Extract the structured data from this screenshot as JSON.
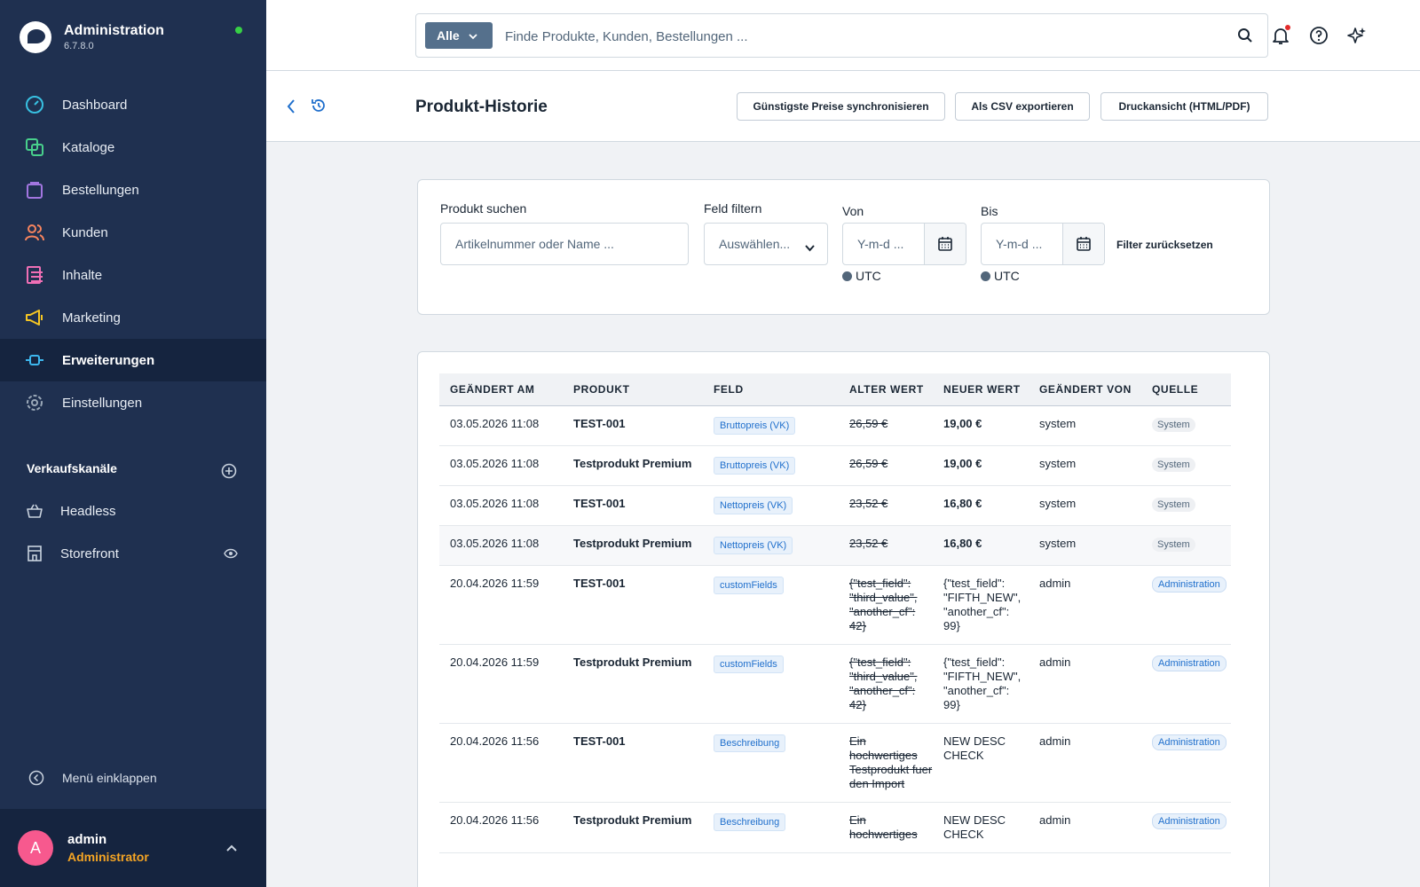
{
  "app": {
    "title": "Administration",
    "version": "6.7.8.0"
  },
  "sidebar": {
    "items": [
      {
        "label": "Dashboard",
        "icon": "dashboard-icon",
        "color": "#38c1e2"
      },
      {
        "label": "Kataloge",
        "icon": "catalog-icon",
        "color": "#48d08c"
      },
      {
        "label": "Bestellungen",
        "icon": "orders-icon",
        "color": "#a276e0"
      },
      {
        "label": "Kunden",
        "icon": "customers-icon",
        "color": "#f7845e"
      },
      {
        "label": "Inhalte",
        "icon": "content-icon",
        "color": "#ef6fb5"
      },
      {
        "label": "Marketing",
        "icon": "marketing-icon",
        "color": "#f5c623"
      },
      {
        "label": "Erweiterungen",
        "icon": "extensions-icon",
        "color": "#3db7ee",
        "active": true
      },
      {
        "label": "Einstellungen",
        "icon": "settings-icon",
        "color": "#9aa8b8"
      }
    ],
    "channels_title": "Verkaufskanäle",
    "channels": [
      {
        "label": "Headless",
        "icon": "basket-icon"
      },
      {
        "label": "Storefront",
        "icon": "storefront-icon"
      }
    ],
    "collapse_label": "Menü einklappen",
    "user": {
      "initial": "A",
      "name": "admin",
      "role": "Administrator"
    }
  },
  "topbar": {
    "search_type": "Alle",
    "search_placeholder": "Finde Produkte, Kunden, Bestellungen ..."
  },
  "page": {
    "title": "Produkt-Historie",
    "buttons": {
      "sync": "Günstigste Preise synchronisieren",
      "csv": "Als CSV exportieren",
      "print": "Druckansicht (HTML/PDF)"
    }
  },
  "filters": {
    "product_label": "Produkt suchen",
    "product_placeholder": "Artikelnummer oder Name ...",
    "field_label": "Feld filtern",
    "field_placeholder": "Auswählen...",
    "from_label": "Von",
    "to_label": "Bis",
    "date_placeholder": "Y-m-d ...",
    "timezone": "UTC",
    "reset": "Filter zurücksetzen"
  },
  "table": {
    "headers": [
      "GEÄNDERT AM",
      "PRODUKT",
      "FELD",
      "ALTER WERT",
      "NEUER WERT",
      "GEÄNDERT VON",
      "QUELLE"
    ],
    "rows": [
      {
        "date": "03.05.2026 11:08",
        "product": "TEST-001",
        "field": "Bruttopreis (VK)",
        "old": "26,59 €",
        "new": "19,00 €",
        "by": "system",
        "source": "System"
      },
      {
        "date": "03.05.2026 11:08",
        "product": "Testprodukt Premium",
        "field": "Bruttopreis (VK)",
        "old": "26,59 €",
        "new": "19,00 €",
        "by": "system",
        "source": "System"
      },
      {
        "date": "03.05.2026 11:08",
        "product": "TEST-001",
        "field": "Nettopreis (VK)",
        "old": "23,52 €",
        "new": "16,80 €",
        "by": "system",
        "source": "System"
      },
      {
        "date": "03.05.2026 11:08",
        "product": "Testprodukt Premium",
        "field": "Nettopreis (VK)",
        "old": "23,52 €",
        "new": "16,80 €",
        "by": "system",
        "source": "System"
      },
      {
        "date": "20.04.2026 11:59",
        "product": "TEST-001",
        "field": "customFields",
        "old": "{\"test_field\": \"third_value\", \"another_cf\": 42}",
        "new": "{\"test_field\": \"FIFTH_NEW\", \"another_cf\": 99}",
        "by": "admin",
        "source": "Administration"
      },
      {
        "date": "20.04.2026 11:59",
        "product": "Testprodukt Premium",
        "field": "customFields",
        "old": "{\"test_field\": \"third_value\", \"another_cf\": 42}",
        "new": "{\"test_field\": \"FIFTH_NEW\", \"another_cf\": 99}",
        "by": "admin",
        "source": "Administration"
      },
      {
        "date": "20.04.2026 11:56",
        "product": "TEST-001",
        "field": "Beschreibung",
        "old": "Ein hochwertiges Testprodukt fuer den Import",
        "new": "NEW DESC CHECK",
        "by": "admin",
        "source": "Administration"
      },
      {
        "date": "20.04.2026 11:56",
        "product": "Testprodukt Premium",
        "field": "Beschreibung",
        "old": "Ein hochwertiges",
        "new": "NEW DESC CHECK",
        "by": "admin",
        "source": "Administration"
      }
    ]
  }
}
